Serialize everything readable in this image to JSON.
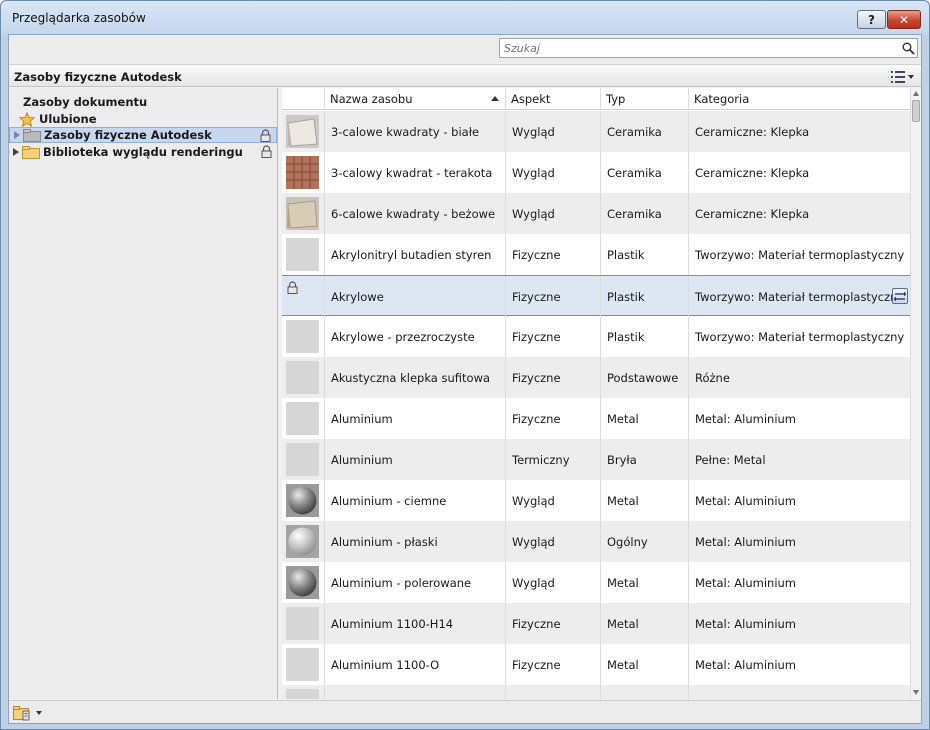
{
  "window": {
    "title": "Przeglądarka zasobów",
    "help_label": "?",
    "close_label": "✕"
  },
  "search": {
    "placeholder": "Szukaj"
  },
  "library_header": {
    "title": "Zasoby fizyczne Autodesk"
  },
  "tree": {
    "items": [
      {
        "label": "Zasoby dokumentu"
      },
      {
        "label": "Ulubione"
      },
      {
        "label": "Zasoby fizyczne Autodesk",
        "locked": true,
        "selected": true
      },
      {
        "label": "Biblioteka wyglądu renderingu",
        "locked": true
      }
    ]
  },
  "grid": {
    "columns": [
      {
        "label": ""
      },
      {
        "label": "Nazwa zasobu",
        "sorted": "asc"
      },
      {
        "label": "Aspekt"
      },
      {
        "label": "Typ"
      },
      {
        "label": "Kategoria"
      }
    ],
    "rows": [
      {
        "name": "3-calowe kwadraty - białe",
        "aspect": "Wygląd",
        "type": "Ceramika",
        "category": "Ceramiczne: Klepka",
        "thumb": "white-tile"
      },
      {
        "name": "3-calowy kwadrat - terakota",
        "aspect": "Wygląd",
        "type": "Ceramika",
        "category": "Ceramiczne: Klepka",
        "thumb": "terracotta-tile"
      },
      {
        "name": "6-calowe kwadraty - beżowe",
        "aspect": "Wygląd",
        "type": "Ceramika",
        "category": "Ceramiczne: Klepka",
        "thumb": "beige-tile"
      },
      {
        "name": "Akrylonitryl butadien styren",
        "aspect": "Fizyczne",
        "type": "Plastik",
        "category": "Tworzywo: Materiał termoplastyczny",
        "thumb": "blank"
      },
      {
        "name": "Akrylowe",
        "aspect": "Fizyczne",
        "type": "Plastik",
        "category": "Tworzywo: Materiał termoplastyczny",
        "thumb": "lock",
        "selected": true
      },
      {
        "name": "Akrylowe - przezroczyste",
        "aspect": "Fizyczne",
        "type": "Plastik",
        "category": "Tworzywo: Materiał termoplastyczny",
        "thumb": "blank"
      },
      {
        "name": "Akustyczna klepka sufitowa",
        "aspect": "Fizyczne",
        "type": "Podstawowe",
        "category": "Różne",
        "thumb": "blank"
      },
      {
        "name": "Aluminium",
        "aspect": "Fizyczne",
        "type": "Metal",
        "category": "Metal: Aluminium",
        "thumb": "blank"
      },
      {
        "name": "Aluminium",
        "aspect": "Termiczny",
        "type": "Bryła",
        "category": "Pełne: Metal",
        "thumb": "blank"
      },
      {
        "name": "Aluminium - ciemne",
        "aspect": "Wygląd",
        "type": "Metal",
        "category": "Metal: Aluminium",
        "thumb": "dark-sphere"
      },
      {
        "name": "Aluminium - płaski",
        "aspect": "Wygląd",
        "type": "Ogólny",
        "category": "Metal: Aluminium",
        "thumb": "light-sphere"
      },
      {
        "name": "Aluminium - polerowane",
        "aspect": "Wygląd",
        "type": "Metal",
        "category": "Metal: Aluminium",
        "thumb": "dark-sphere"
      },
      {
        "name": "Aluminium 1100-H14",
        "aspect": "Fizyczne",
        "type": "Metal",
        "category": "Metal: Aluminium",
        "thumb": "blank"
      },
      {
        "name": "Aluminium 1100-O",
        "aspect": "Fizyczne",
        "type": "Metal",
        "category": "Metal: Aluminium",
        "thumb": "blank"
      },
      {
        "name": "",
        "aspect": "",
        "type": "",
        "category": "",
        "thumb": "blank"
      }
    ]
  },
  "colors": {
    "selection": "#c5d8f0",
    "window_frame": "#bdd0e6",
    "row_alt": "#ededed"
  }
}
